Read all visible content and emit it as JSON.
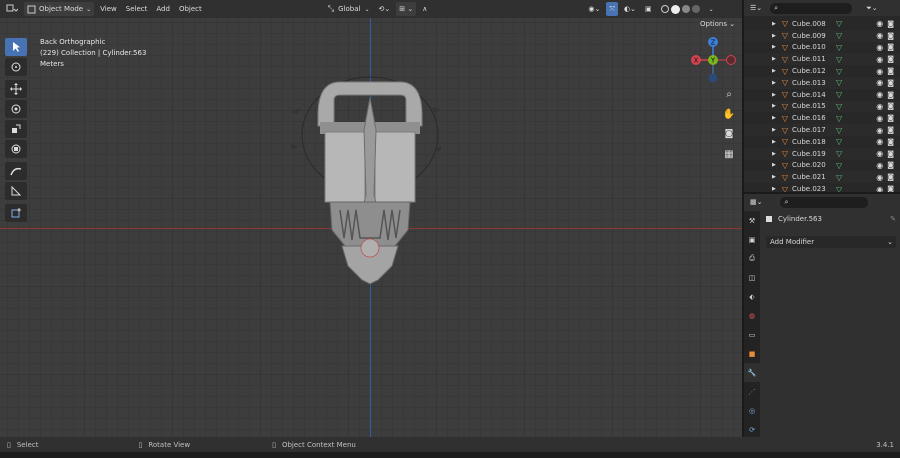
{
  "header": {
    "mode": "Object Mode",
    "menus": [
      "View",
      "Select",
      "Add",
      "Object"
    ],
    "orientation": "Global",
    "options": "Options"
  },
  "viewport": {
    "view_name": "Back Orthographic",
    "collection": "(229) Collection | Cylinder.563",
    "units": "Meters",
    "gizmo": {
      "x": "X",
      "y": "Y",
      "z": "Z"
    }
  },
  "outliner": {
    "items": [
      "Cube.008",
      "Cube.009",
      "Cube.010",
      "Cube.011",
      "Cube.012",
      "Cube.013",
      "Cube.014",
      "Cube.015",
      "Cube.016",
      "Cube.017",
      "Cube.018",
      "Cube.019",
      "Cube.020",
      "Cube.021",
      "Cube.023"
    ]
  },
  "properties": {
    "object_name": "Cylinder.563",
    "add_modifier": "Add Modifier"
  },
  "statusbar": {
    "select": "Select",
    "rotate": "Rotate View",
    "context": "Object Context Menu",
    "version": "3.4.1"
  },
  "colors": {
    "accent": "#4772b3",
    "x_axis": "#d1434e",
    "y_axis": "#79b620",
    "z_axis": "#3e7fdb",
    "object_orange": "#e88b3a",
    "mesh_green": "#5bbf7a"
  }
}
